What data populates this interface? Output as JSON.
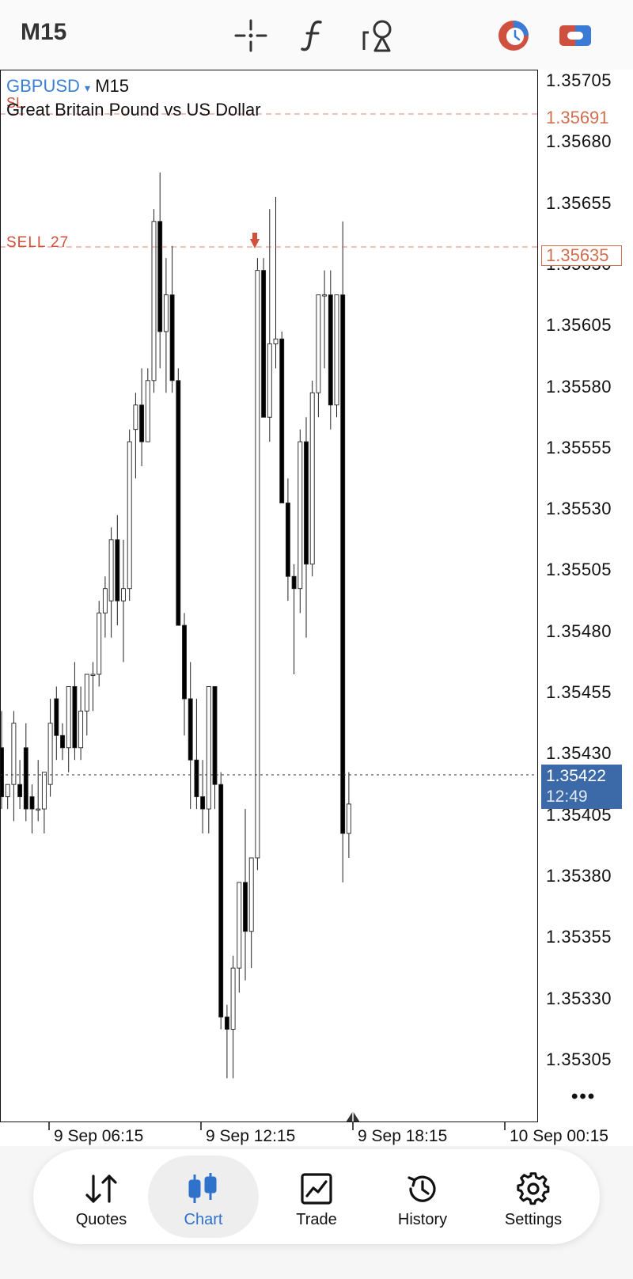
{
  "toolbar": {
    "timeframe": "M15",
    "icons": [
      "crosshair-icon",
      "indicators-icon",
      "objects-icon",
      "account-icon",
      "trade-icon"
    ]
  },
  "chart": {
    "symbol": "GBPUSD",
    "dropdown_glyph": "▾",
    "timeframe": "M15",
    "description": "Great Britain Pound vs US Dollar",
    "sl_label": "SL",
    "sell_label": "SELL 27",
    "sl_price": "1.35691",
    "sell_price": "1.35635",
    "current_price": "1.35422",
    "countdown": "12:49",
    "more_glyph": "•••",
    "colors": {
      "accent": "#3b7fd6",
      "order_line": "#d0503c",
      "price_box": "#3c6aa8"
    }
  },
  "chart_data": {
    "type": "candlestick",
    "price_ticks": [
      "1.35705",
      "1.35680",
      "1.35655",
      "1.35630",
      "1.35605",
      "1.35580",
      "1.35555",
      "1.35530",
      "1.35505",
      "1.35480",
      "1.35455",
      "1.35430",
      "1.35405",
      "1.35380",
      "1.35355",
      "1.35330",
      "1.35305"
    ],
    "time_ticks": [
      "9 Sep 06:15",
      "9 Sep 12:15",
      "9 Sep 18:15",
      "10 Sep 00:15"
    ],
    "y_range": [
      1.35292,
      1.35722
    ],
    "candles": [
      [
        1.35445,
        1.3546,
        1.3542,
        1.35425
      ],
      [
        1.35425,
        1.3543,
        1.3542,
        1.3543
      ],
      [
        1.3543,
        1.3546,
        1.35415,
        1.35455
      ],
      [
        1.3543,
        1.3544,
        1.3542,
        1.35425
      ],
      [
        1.35445,
        1.35455,
        1.35415,
        1.3542
      ],
      [
        1.35425,
        1.3543,
        1.3541,
        1.3542
      ],
      [
        1.3542,
        1.3544,
        1.35415,
        1.3542
      ],
      [
        1.3542,
        1.35435,
        1.3541,
        1.35435
      ],
      [
        1.3543,
        1.35465,
        1.35425,
        1.35455
      ],
      [
        1.35465,
        1.3547,
        1.3544,
        1.3545
      ],
      [
        1.3545,
        1.35455,
        1.3544,
        1.35445
      ],
      [
        1.35445,
        1.3547,
        1.35435,
        1.3547
      ],
      [
        1.3547,
        1.3548,
        1.3544,
        1.35445
      ],
      [
        1.35445,
        1.3547,
        1.3544,
        1.3546
      ],
      [
        1.3546,
        1.3547,
        1.3545,
        1.35475
      ],
      [
        1.35475,
        1.3548,
        1.3546,
        1.35475
      ],
      [
        1.35475,
        1.35505,
        1.3547,
        1.355
      ],
      [
        1.355,
        1.35515,
        1.3549,
        1.3551
      ],
      [
        1.35505,
        1.35535,
        1.3549,
        1.3553
      ],
      [
        1.3553,
        1.3554,
        1.35495,
        1.35505
      ],
      [
        1.35505,
        1.3553,
        1.3548,
        1.3551
      ],
      [
        1.3551,
        1.35575,
        1.35505,
        1.3557
      ],
      [
        1.35575,
        1.3559,
        1.35555,
        1.35585
      ],
      [
        1.35585,
        1.356,
        1.3556,
        1.3557
      ],
      [
        1.3557,
        1.356,
        1.3557,
        1.35595
      ],
      [
        1.35595,
        1.35665,
        1.3559,
        1.3566
      ],
      [
        1.3566,
        1.3568,
        1.356,
        1.35615
      ],
      [
        1.35615,
        1.35645,
        1.3559,
        1.3563
      ],
      [
        1.3563,
        1.3565,
        1.3559,
        1.35595
      ],
      [
        1.35595,
        1.356,
        1.35495,
        1.35495
      ],
      [
        1.35495,
        1.355,
        1.3545,
        1.35465
      ],
      [
        1.35465,
        1.3548,
        1.3542,
        1.3544
      ],
      [
        1.3544,
        1.35465,
        1.3542,
        1.35425
      ],
      [
        1.35425,
        1.3544,
        1.3541,
        1.3542
      ],
      [
        1.3542,
        1.3547,
        1.3541,
        1.3547
      ],
      [
        1.3547,
        1.3547,
        1.3542,
        1.3543
      ],
      [
        1.3543,
        1.35435,
        1.3533,
        1.35335
      ],
      [
        1.35335,
        1.3534,
        1.3531,
        1.3533
      ],
      [
        1.3533,
        1.3536,
        1.3531,
        1.35355
      ],
      [
        1.35355,
        1.3539,
        1.35345,
        1.3539
      ],
      [
        1.3539,
        1.3542,
        1.3535,
        1.3537
      ],
      [
        1.3537,
        1.35395,
        1.35355,
        1.354
      ],
      [
        1.354,
        1.35645,
        1.35395,
        1.3564
      ],
      [
        1.3564,
        1.35645,
        1.3558,
        1.3558
      ],
      [
        1.3558,
        1.35665,
        1.3557,
        1.3561
      ],
      [
        1.3561,
        1.3567,
        1.356,
        1.35612
      ],
      [
        1.35612,
        1.35615,
        1.35545,
        1.35545
      ],
      [
        1.35545,
        1.35555,
        1.35505,
        1.35515
      ],
      [
        1.35515,
        1.3552,
        1.35475,
        1.3551
      ],
      [
        1.3551,
        1.35575,
        1.355,
        1.3557
      ],
      [
        1.3557,
        1.3558,
        1.3549,
        1.3552
      ],
      [
        1.3552,
        1.35595,
        1.35515,
        1.3559
      ],
      [
        1.3559,
        1.3562,
        1.3558,
        1.3563
      ],
      [
        1.3563,
        1.3564,
        1.356,
        1.3563
      ],
      [
        1.3563,
        1.3564,
        1.35575,
        1.35585
      ],
      [
        1.35585,
        1.3563,
        1.3558,
        1.3563
      ],
      [
        1.3563,
        1.3566,
        1.3539,
        1.3541
      ],
      [
        1.3541,
        1.35435,
        1.354,
        1.35422
      ]
    ]
  },
  "nav": {
    "items": [
      {
        "label": "Quotes",
        "icon": "quotes-icon"
      },
      {
        "label": "Chart",
        "icon": "chart-icon"
      },
      {
        "label": "Trade",
        "icon": "trade-icon"
      },
      {
        "label": "History",
        "icon": "history-icon"
      },
      {
        "label": "Settings",
        "icon": "settings-icon"
      }
    ],
    "active": "Chart"
  }
}
